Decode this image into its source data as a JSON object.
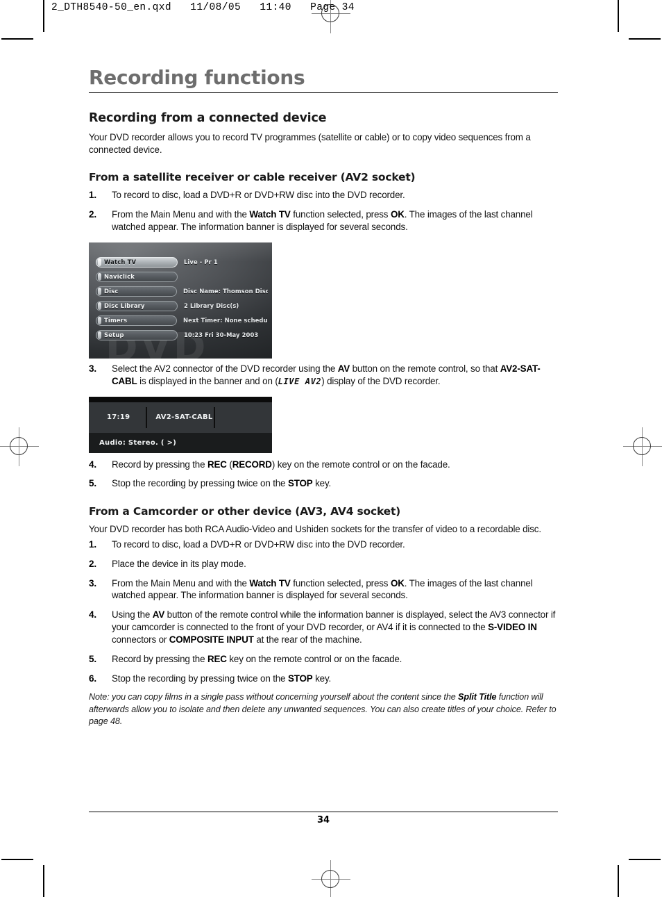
{
  "slug": {
    "text": "2_DTH8540-50_en.qxd   11/08/05   11:40   Page 34"
  },
  "page": {
    "title": "Recording functions",
    "number": "34"
  },
  "sections": [
    {
      "heading": "Recording from a connected device",
      "intro": "Your DVD recorder allows you to record TV programmes (satellite or cable) or to copy video sequences from a connected device."
    }
  ],
  "sub1": {
    "heading": "From a satellite receiver or cable receiver (AV2 socket)",
    "steps": [
      {
        "num": "1.",
        "parts": [
          {
            "t": "To record to disc, load a DVD+R or DVD+RW disc into the DVD recorder.",
            "b": false
          }
        ]
      },
      {
        "num": "2.",
        "parts": [
          {
            "t": "From the Main Menu and with the ",
            "b": false
          },
          {
            "t": "Watch TV",
            "b": true
          },
          {
            "t": " function selected, press ",
            "b": false
          },
          {
            "t": "OK",
            "b": true
          },
          {
            "t": ". The images of the last channel watched appear. The information banner is displayed for several seconds.",
            "b": false
          }
        ]
      },
      {
        "num": "3.",
        "parts": [
          {
            "t": "Select the AV2 connector of the DVD recorder using the ",
            "b": false
          },
          {
            "t": "AV",
            "b": true
          },
          {
            "t": " button on the remote control, so that ",
            "b": false
          },
          {
            "t": "AV2-SAT-CABL",
            "b": true
          },
          {
            "t": " is displayed in the banner and on (",
            "b": false
          },
          {
            "t": "LIVE AV2",
            "b": false,
            "lcd": true
          },
          {
            "t": ") display of the DVD recorder.",
            "b": false
          }
        ]
      },
      {
        "num": "4.",
        "parts": [
          {
            "t": "Record by pressing the ",
            "b": false
          },
          {
            "t": "REC",
            "b": true
          },
          {
            "t": " (",
            "b": false
          },
          {
            "t": "RECORD",
            "b": true
          },
          {
            "t": ") key on the remote control or on the facade.",
            "b": false
          }
        ]
      },
      {
        "num": "5.",
        "parts": [
          {
            "t": "Stop the recording by pressing twice on the ",
            "b": false
          },
          {
            "t": "STOP",
            "b": true
          },
          {
            "t": " key.",
            "b": false
          }
        ]
      }
    ]
  },
  "sub2": {
    "heading": "From a Camcorder or other device (AV3, AV4 socket)",
    "intro": "Your DVD recorder has both RCA Audio-Video and Ushiden sockets for the transfer of video to a recordable disc.",
    "steps": [
      {
        "num": "1.",
        "parts": [
          {
            "t": "To record to disc, load a DVD+R or DVD+RW disc into the DVD recorder.",
            "b": false
          }
        ]
      },
      {
        "num": "2.",
        "parts": [
          {
            "t": "Place the device in its play mode.",
            "b": false
          }
        ]
      },
      {
        "num": "3.",
        "parts": [
          {
            "t": "From the Main Menu and with the ",
            "b": false
          },
          {
            "t": "Watch TV",
            "b": true
          },
          {
            "t": " function selected, press ",
            "b": false
          },
          {
            "t": "OK",
            "b": true
          },
          {
            "t": ". The images of the last channel watched appear. The information banner is displayed for several seconds.",
            "b": false
          }
        ]
      },
      {
        "num": "4.",
        "parts": [
          {
            "t": "Using the ",
            "b": false
          },
          {
            "t": "AV",
            "b": true
          },
          {
            "t": " button of the remote control while the information banner is displayed, select the AV3 connector if your camcorder is connected to the front of your DVD recorder, or AV4 if it is connected to the ",
            "b": false
          },
          {
            "t": "S-VIDEO IN",
            "b": true
          },
          {
            "t": " connectors or ",
            "b": false
          },
          {
            "t": "COMPOSITE INPUT",
            "b": true
          },
          {
            "t": " at the rear of the machine.",
            "b": false
          }
        ]
      },
      {
        "num": "5.",
        "parts": [
          {
            "t": "Record by pressing the ",
            "b": false
          },
          {
            "t": "REC",
            "b": true
          },
          {
            "t": " key on the remote control or on the facade.",
            "b": false
          }
        ]
      },
      {
        "num": "6.",
        "parts": [
          {
            "t": "Stop the recording by pressing twice on the ",
            "b": false
          },
          {
            "t": "STOP",
            "b": true
          },
          {
            "t": " key.",
            "b": false
          }
        ]
      }
    ],
    "note": {
      "parts": [
        {
          "t": "Note: you can copy films in a single pass without concerning yourself about the content since the ",
          "b": false
        },
        {
          "t": "Split Title",
          "b": true
        },
        {
          "t": " function will afterwards allow you to isolate and then delete any unwanted sequences. You can also create titles of your choice. Refer to page 48.",
          "b": false
        }
      ]
    }
  },
  "figure_menu": {
    "watermark": "DVD",
    "rows": [
      {
        "label": "Watch TV",
        "value": "Live - Pr 1",
        "selected": true
      },
      {
        "label": "Naviclick",
        "value": "",
        "selected": false
      },
      {
        "label": "Disc",
        "value": "Disc Name: Thomson Disc",
        "selected": false
      },
      {
        "label": "Disc Library",
        "value": "2 Library Disc(s)",
        "selected": false
      },
      {
        "label": "Timers",
        "value": "Next Timer: None schedule",
        "selected": false
      },
      {
        "label": "Setup",
        "value": "10:23 Fri 30-May 2003",
        "selected": false
      }
    ]
  },
  "figure_banner": {
    "time": "17:19",
    "source": "AV2-SAT-CABL",
    "audio": "Audio: Stereo.  ( >)"
  }
}
